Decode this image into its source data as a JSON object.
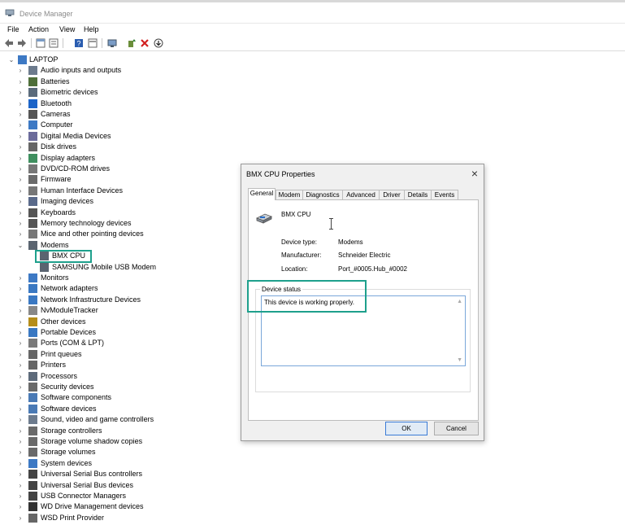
{
  "window": {
    "title": "Device Manager"
  },
  "menu": [
    "File",
    "Action",
    "View",
    "Help"
  ],
  "tree": {
    "root": "LAPTOP",
    "items": [
      {
        "label": "Audio inputs and outputs",
        "icon": "speaker-icon"
      },
      {
        "label": "Batteries",
        "icon": "battery-icon"
      },
      {
        "label": "Biometric devices",
        "icon": "fingerprint-icon"
      },
      {
        "label": "Bluetooth",
        "icon": "bluetooth-icon"
      },
      {
        "label": "Cameras",
        "icon": "camera-icon"
      },
      {
        "label": "Computer",
        "icon": "monitor-icon"
      },
      {
        "label": "Digital Media Devices",
        "icon": "media-icon"
      },
      {
        "label": "Disk drives",
        "icon": "disk-icon"
      },
      {
        "label": "Display adapters",
        "icon": "display-adapter-icon"
      },
      {
        "label": "DVD/CD-ROM drives",
        "icon": "dvd-icon"
      },
      {
        "label": "Firmware",
        "icon": "firmware-icon"
      },
      {
        "label": "Human Interface Devices",
        "icon": "hid-icon"
      },
      {
        "label": "Imaging devices",
        "icon": "imaging-icon"
      },
      {
        "label": "Keyboards",
        "icon": "keyboard-icon"
      },
      {
        "label": "Memory technology devices",
        "icon": "memory-icon"
      },
      {
        "label": "Mice and other pointing devices",
        "icon": "mouse-icon"
      },
      {
        "label": "Modems",
        "icon": "modem-icon",
        "expanded": true,
        "children": [
          {
            "label": "BMX CPU",
            "icon": "modem-icon",
            "selected": true
          },
          {
            "label": "SAMSUNG Mobile USB Modem",
            "icon": "modem-icon"
          }
        ]
      },
      {
        "label": "Monitors",
        "icon": "monitor-icon"
      },
      {
        "label": "Network adapters",
        "icon": "network-icon"
      },
      {
        "label": "Network Infrastructure Devices",
        "icon": "network-icon"
      },
      {
        "label": "NvModuleTracker",
        "icon": "module-icon"
      },
      {
        "label": "Other devices",
        "icon": "unknown-device-icon"
      },
      {
        "label": "Portable Devices",
        "icon": "portable-icon"
      },
      {
        "label": "Ports (COM & LPT)",
        "icon": "port-icon"
      },
      {
        "label": "Print queues",
        "icon": "printer-icon"
      },
      {
        "label": "Printers",
        "icon": "printer-icon"
      },
      {
        "label": "Processors",
        "icon": "cpu-icon"
      },
      {
        "label": "Security devices",
        "icon": "security-icon"
      },
      {
        "label": "Software components",
        "icon": "software-icon"
      },
      {
        "label": "Software devices",
        "icon": "software-icon"
      },
      {
        "label": "Sound, video and game controllers",
        "icon": "sound-icon"
      },
      {
        "label": "Storage controllers",
        "icon": "storage-icon"
      },
      {
        "label": "Storage volume shadow copies",
        "icon": "storage-icon"
      },
      {
        "label": "Storage volumes",
        "icon": "storage-icon"
      },
      {
        "label": "System devices",
        "icon": "system-icon"
      },
      {
        "label": "Universal Serial Bus controllers",
        "icon": "usb-icon"
      },
      {
        "label": "Universal Serial Bus devices",
        "icon": "usb-icon"
      },
      {
        "label": "USB Connector Managers",
        "icon": "usb-icon"
      },
      {
        "label": "WD Drive Management devices",
        "icon": "wd-icon"
      },
      {
        "label": "WSD Print Provider",
        "icon": "printer-icon"
      }
    ]
  },
  "dialog": {
    "title": "BMX CPU Properties",
    "tabs": [
      "General",
      "Modem",
      "Diagnostics",
      "Advanced",
      "Driver",
      "Details",
      "Events"
    ],
    "device_name": "BMX CPU",
    "fields": [
      {
        "label": "Device type:",
        "value": "Modems"
      },
      {
        "label": "Manufacturer:",
        "value": "Schneider Electric"
      },
      {
        "label": "Location:",
        "value": "Port_#0005.Hub_#0002"
      }
    ],
    "status_legend": "Device status",
    "status_text": "This device is working properly.",
    "ok_label": "OK",
    "cancel_label": "Cancel"
  }
}
